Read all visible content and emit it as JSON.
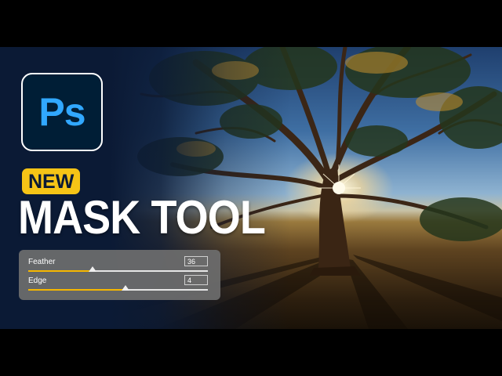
{
  "logo": {
    "text": "Ps",
    "bg_color": "#001e36",
    "text_color": "#31a8ff",
    "icon": "photoshop-logo-icon"
  },
  "badge": {
    "text": "NEW",
    "color": "#f6c416"
  },
  "headline": "MASK TOOL",
  "panel": {
    "sliders": [
      {
        "label": "Feather",
        "value": "36",
        "fraction": 0.36
      },
      {
        "label": "Edge",
        "value": "4",
        "fraction": 0.54
      }
    ],
    "accent_color": "#f6b700"
  }
}
